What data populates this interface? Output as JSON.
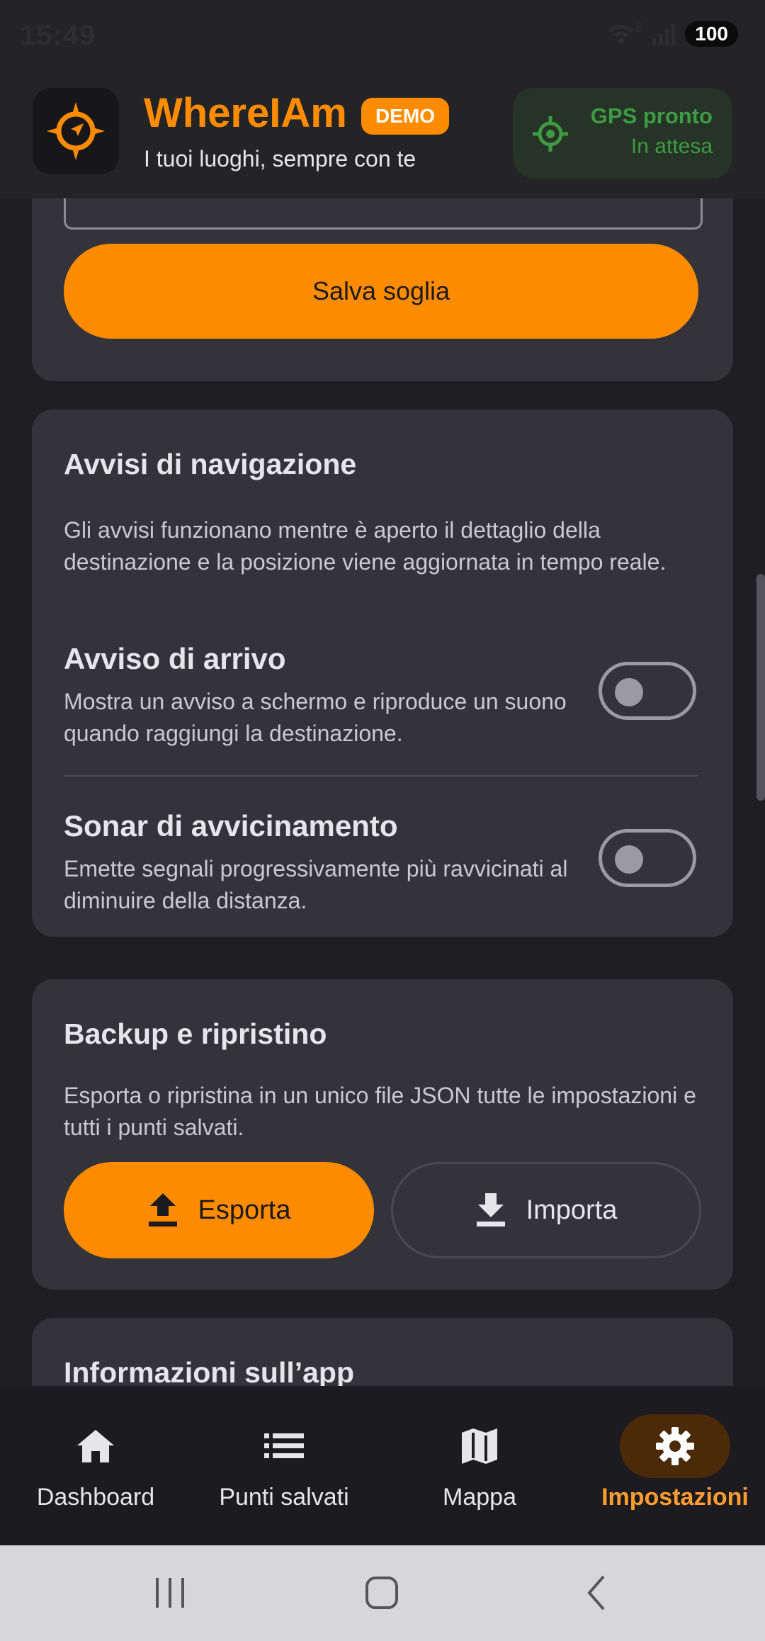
{
  "status_bar": {
    "time": "15:49",
    "battery": "100",
    "network": "6"
  },
  "header": {
    "title": "WhereIAm",
    "badge": "DEMO",
    "subtitle": "I tuoi luoghi, sempre con te",
    "gps_status": "GPS pronto",
    "gps_substatus": "In attesa",
    "icons": {
      "logo": "compass-icon",
      "gps": "gps-target-icon"
    }
  },
  "threshold_card": {
    "save_label": "Salva soglia"
  },
  "alerts_card": {
    "title": "Avvisi di navigazione",
    "description": "Gli avvisi funzionano mentre è aperto il dettaglio della destinazione e la posizione viene aggiornata in tempo reale.",
    "settings": [
      {
        "title": "Avviso di arrivo",
        "description": "Mostra un avviso a schermo e riproduce un suono quando raggiungi la destinazione.",
        "enabled": false
      },
      {
        "title": "Sonar di avvicinamento",
        "description": "Emette segnali progressivamente più ravvicinati al diminuire della distanza.",
        "enabled": false
      }
    ]
  },
  "backup_card": {
    "title": "Backup e ripristino",
    "description": "Esporta o ripristina in un unico file JSON tutte le impostazioni e tutti i punti salvati.",
    "export_label": "Esporta",
    "import_label": "Importa"
  },
  "info_card": {
    "title": "Informazioni sull’app"
  },
  "bottom_nav": {
    "items": [
      {
        "label": "Dashboard",
        "icon": "home-icon"
      },
      {
        "label": "Punti salvati",
        "icon": "list-icon"
      },
      {
        "label": "Mappa",
        "icon": "map-icon"
      },
      {
        "label": "Impostazioni",
        "icon": "gear-icon",
        "active": true
      }
    ]
  },
  "colors": {
    "accent": "#ff8c00",
    "gps_green": "#3f9a44",
    "card": "#343339",
    "background": "#1f1f23"
  }
}
